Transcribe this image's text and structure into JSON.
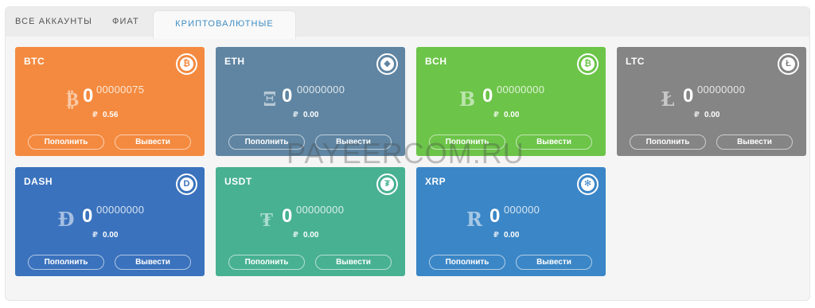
{
  "tabs": [
    {
      "label": "ВСЕ АККАУНТЫ"
    },
    {
      "label": "ФИАТ"
    },
    {
      "label": "КРИПТОВАЛЮТНЫЕ"
    }
  ],
  "active_tab": "КРИПТОВАЛЮТНЫЕ",
  "deposit_label": "Пополнить",
  "withdraw_label": "Вывести",
  "rub_sign": "₽",
  "watermark": "PAYEERCOM.RU",
  "cards": [
    {
      "code": "BTC",
      "symbol": "₿",
      "amount": "0",
      "decimals": "00000075",
      "rub": "0.56",
      "color": "#f48a3f",
      "icon": "bitcoin-icon",
      "badge_glyph": "₿"
    },
    {
      "code": "ETH",
      "symbol": "Ξ",
      "amount": "0",
      "decimals": "00000000",
      "rub": "0.00",
      "color": "#5f85a2",
      "icon": "ethereum-icon",
      "badge_glyph": "◆"
    },
    {
      "code": "BCH",
      "symbol": "B",
      "amount": "0",
      "decimals": "00000000",
      "rub": "0.00",
      "color": "#6cc449",
      "icon": "bitcoin-cash-icon",
      "badge_glyph": "₿"
    },
    {
      "code": "LTC",
      "symbol": "Ł",
      "amount": "0",
      "decimals": "00000000",
      "rub": "0.00",
      "color": "#858585",
      "icon": "litecoin-icon",
      "badge_glyph": "Ł"
    },
    {
      "code": "DASH",
      "symbol": "Đ",
      "amount": "0",
      "decimals": "00000000",
      "rub": "0.00",
      "color": "#3a72bd",
      "icon": "dash-icon",
      "badge_glyph": "D"
    },
    {
      "code": "USDT",
      "symbol": "₮",
      "amount": "0",
      "decimals": "00000000",
      "rub": "0.00",
      "color": "#48b192",
      "icon": "tether-icon",
      "badge_glyph": "₮"
    },
    {
      "code": "XRP",
      "symbol": "R",
      "amount": "0",
      "decimals": "000000",
      "rub": "0.00",
      "color": "#3b86c6",
      "icon": "ripple-icon",
      "badge_glyph": "✻"
    }
  ]
}
